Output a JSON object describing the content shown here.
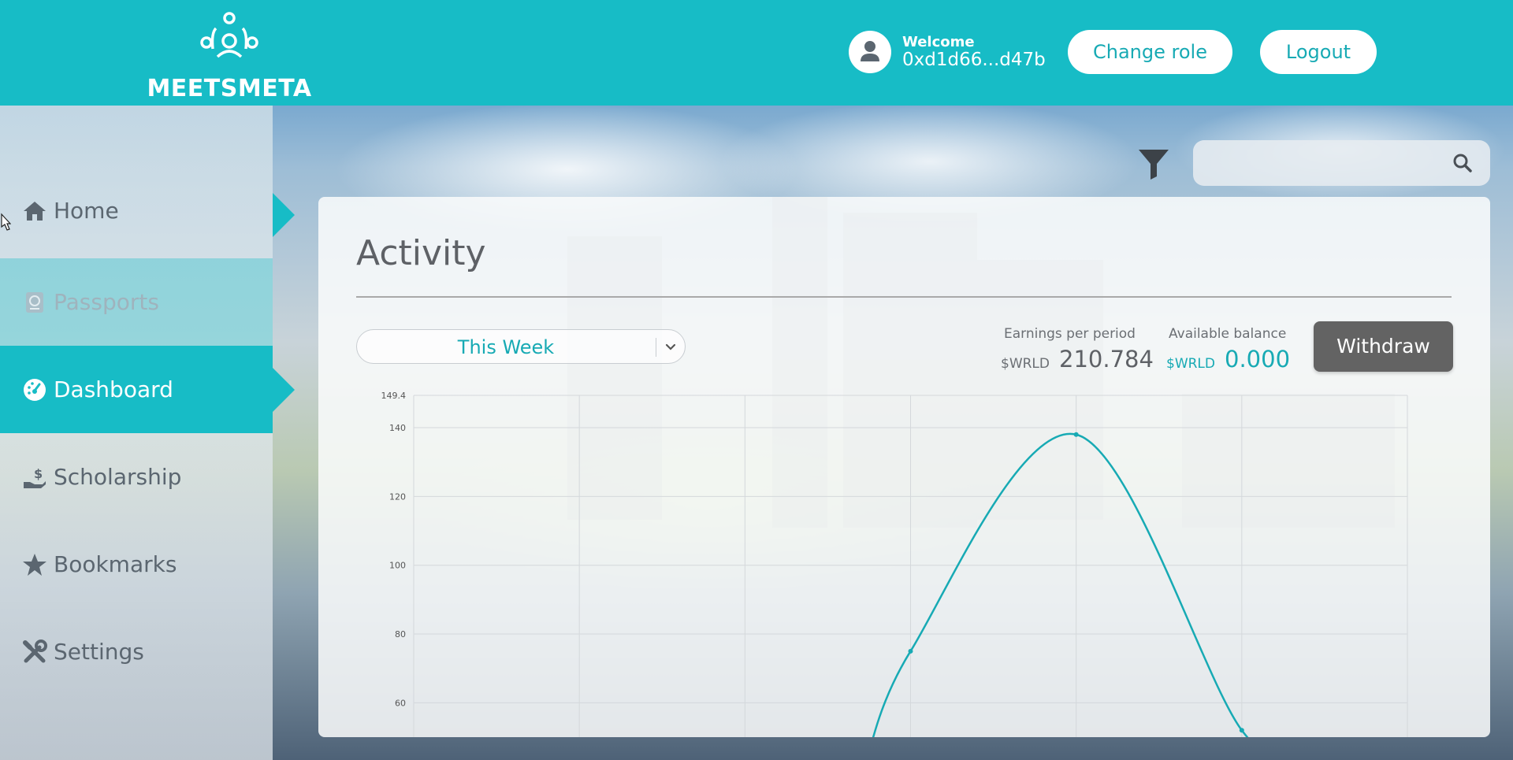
{
  "brand": {
    "name": "MEETSMETA"
  },
  "header": {
    "welcome_label": "Welcome",
    "wallet_address": "0xd1d66...d47b",
    "change_role_label": "Change role",
    "logout_label": "Logout"
  },
  "sidebar": {
    "items": [
      {
        "label": "Home",
        "icon": "home-icon",
        "state": "hover"
      },
      {
        "label": "Passports",
        "icon": "passport-icon",
        "state": "disabled"
      },
      {
        "label": "Dashboard",
        "icon": "dashboard-icon",
        "state": "active"
      },
      {
        "label": "Scholarship",
        "icon": "scholarship-icon",
        "state": "normal"
      },
      {
        "label": "Bookmarks",
        "icon": "star-icon",
        "state": "normal"
      },
      {
        "label": "Settings",
        "icon": "tools-icon",
        "state": "normal"
      }
    ]
  },
  "search": {
    "value": "",
    "placeholder": ""
  },
  "activity": {
    "title": "Activity",
    "period": "This Week",
    "earnings_label": "Earnings per period",
    "earnings_unit": "$WRLD",
    "earnings_value": "210.784",
    "balance_label": "Available balance",
    "balance_unit": "$WRLD",
    "balance_value": "0.000",
    "withdraw_label": "Withdraw"
  },
  "colors": {
    "accent": "#17bcc6",
    "accent_text": "#17aab4",
    "button_dark": "#636363",
    "text_gray": "#5e6166"
  },
  "chart_data": {
    "type": "line",
    "title": "",
    "xlabel": "",
    "ylabel": "",
    "ylim": [
      50,
      149.4
    ],
    "yticks": [
      "149.4",
      "140",
      "120",
      "100",
      "80",
      "60"
    ],
    "x": [
      0,
      1,
      2,
      3,
      4,
      5,
      6
    ],
    "series": [
      {
        "values": [
          null,
          null,
          null,
          75,
          138,
          52,
          null
        ]
      }
    ],
    "grid": true,
    "line_color": "#17aab4"
  }
}
